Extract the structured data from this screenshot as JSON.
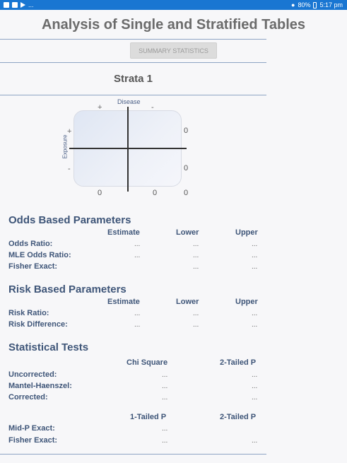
{
  "status_bar": {
    "left_text": "...",
    "battery": "80%",
    "time": "5:17 pm"
  },
  "title": "Analysis of Single and Stratified Tables",
  "summary_button": "SUMMARY STATISTICS",
  "strata_title": "Strata 1",
  "table2x2": {
    "disease_label": "Disease",
    "exposure_label": "Exposure",
    "plus": "+",
    "minus": "-",
    "row1_total": "0",
    "row2_total": "0",
    "col1_total": "0",
    "col2_total": "0",
    "grand_total": "0"
  },
  "odds": {
    "title": "Odds Based Parameters",
    "headers": [
      "Estimate",
      "Lower",
      "Upper"
    ],
    "rows": [
      {
        "label": "Odds Ratio:",
        "estimate": "...",
        "lower": "...",
        "upper": "..."
      },
      {
        "label": "MLE Odds Ratio:",
        "estimate": "...",
        "lower": "...",
        "upper": "..."
      },
      {
        "label": "Fisher Exact:",
        "lower": "...",
        "upper": "..."
      }
    ]
  },
  "risk": {
    "title": "Risk Based Parameters",
    "headers": [
      "Estimate",
      "Lower",
      "Upper"
    ],
    "rows": [
      {
        "label": "Risk Ratio:",
        "estimate": "...",
        "lower": "...",
        "upper": "..."
      },
      {
        "label": "Risk Difference:",
        "estimate": "...",
        "lower": "...",
        "upper": "..."
      }
    ]
  },
  "tests": {
    "title": "Statistical Tests",
    "headers1": [
      "Chi Square",
      "2-Tailed P"
    ],
    "rows1": [
      {
        "label": "Uncorrected:",
        "a": "...",
        "b": "..."
      },
      {
        "label": "Mantel-Haenszel:",
        "a": "...",
        "b": "..."
      },
      {
        "label": "Corrected:",
        "a": "...",
        "b": "..."
      }
    ],
    "headers2": [
      "1-Tailed P",
      "2-Tailed P"
    ],
    "rows2": [
      {
        "label": "Mid-P Exact:",
        "a": "..."
      },
      {
        "label": "Fisher Exact:",
        "a": "...",
        "b": "..."
      }
    ]
  }
}
